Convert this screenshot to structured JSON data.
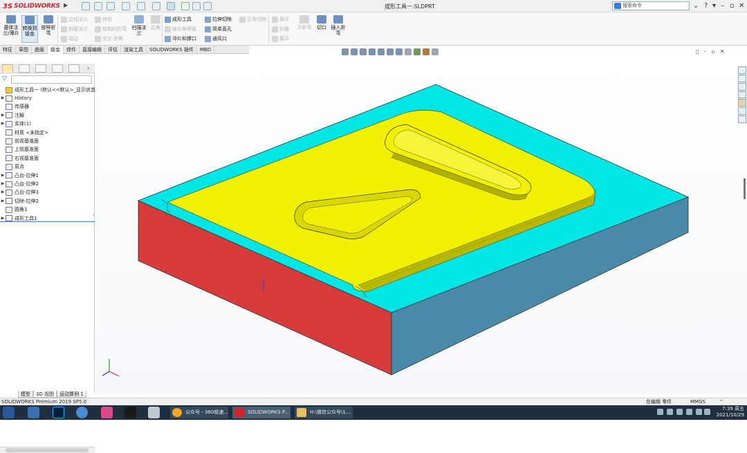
{
  "app": {
    "logo_ds": "3S",
    "logo_name": "SOLIDWORKS",
    "document_title": "成形工具一.SLDPRT",
    "search_placeholder": "搜索命令"
  },
  "ribbon": {
    "big_buttons": [
      {
        "label": "基体法兰/薄片",
        "name": "base-flange-button"
      },
      {
        "label": "转换到钣金",
        "name": "convert-to-sheet-metal-button"
      },
      {
        "label": "放样折弯",
        "name": "lofted-bend-button"
      }
    ],
    "col1": [
      "边线法兰",
      "斜接法兰",
      "褶边"
    ],
    "col2": [
      "转折",
      "绘制的折弯",
      "交叉-折断"
    ],
    "swept_flange": "扫描法兰",
    "corner": "边角",
    "col3": [
      "成形工具",
      "被合角撑板",
      "通风口"
    ],
    "col3b": [
      "冲片和撑口"
    ],
    "col4": [
      "拉伸切除",
      "简单直孔",
      "通风口"
    ],
    "normal_cut": "正常切除",
    "col5": [
      "展开",
      "折叠",
      "展平"
    ],
    "no_bends": "不折弯",
    "rip": "切口",
    "insert_bends": "插入折弯"
  },
  "command_tabs": [
    "特征",
    "草图",
    "曲面",
    "钣金",
    "焊件",
    "直接编辑",
    "评估",
    "渲染工具",
    "SOLIDWORKS 插件",
    "MBD"
  ],
  "active_tab_index": 3,
  "feature_tree": {
    "root": "成形工具一 (默认<<默认>_显示状态 1",
    "items": [
      {
        "label": "History",
        "expandable": true
      },
      {
        "label": "传感器",
        "expandable": false
      },
      {
        "label": "注解",
        "expandable": true
      },
      {
        "label": "实体(1)",
        "expandable": true
      },
      {
        "label": "材质 <未指定>",
        "expandable": false
      },
      {
        "label": "前视基准面",
        "expandable": false
      },
      {
        "label": "上视基准面",
        "expandable": false
      },
      {
        "label": "右视基准面",
        "expandable": false
      },
      {
        "label": "原点",
        "expandable": false
      },
      {
        "label": "凸台-拉伸1",
        "expandable": true
      },
      {
        "label": "凸台-拉伸2",
        "expandable": true
      },
      {
        "label": "凸台-拉伸3",
        "expandable": true
      },
      {
        "label": "切除-拉伸2",
        "expandable": true
      },
      {
        "label": "圆角1",
        "expandable": false
      },
      {
        "label": "成形工具1",
        "expandable": true
      }
    ]
  },
  "bottom_tabs": [
    "模型",
    "3D 视图",
    "运动算例 1"
  ],
  "status": {
    "left": "SOLIDWORKS Premium 2019 SP5.0",
    "mode": "在编辑 零件",
    "units": "MMGS"
  },
  "taskbar": {
    "apps": [
      "公众号 - 360极速...",
      "SOLIDWORKS P...",
      "H:\\微信公众号\\1..."
    ],
    "time": "7:39 周五",
    "date": "2021/10/29"
  },
  "colors": {
    "top_face": "#00e6e6",
    "boss_face": "#f0f000",
    "front_face": "#d63a3a",
    "side_face": "#4a8aa8",
    "accent": "#d2232a"
  }
}
